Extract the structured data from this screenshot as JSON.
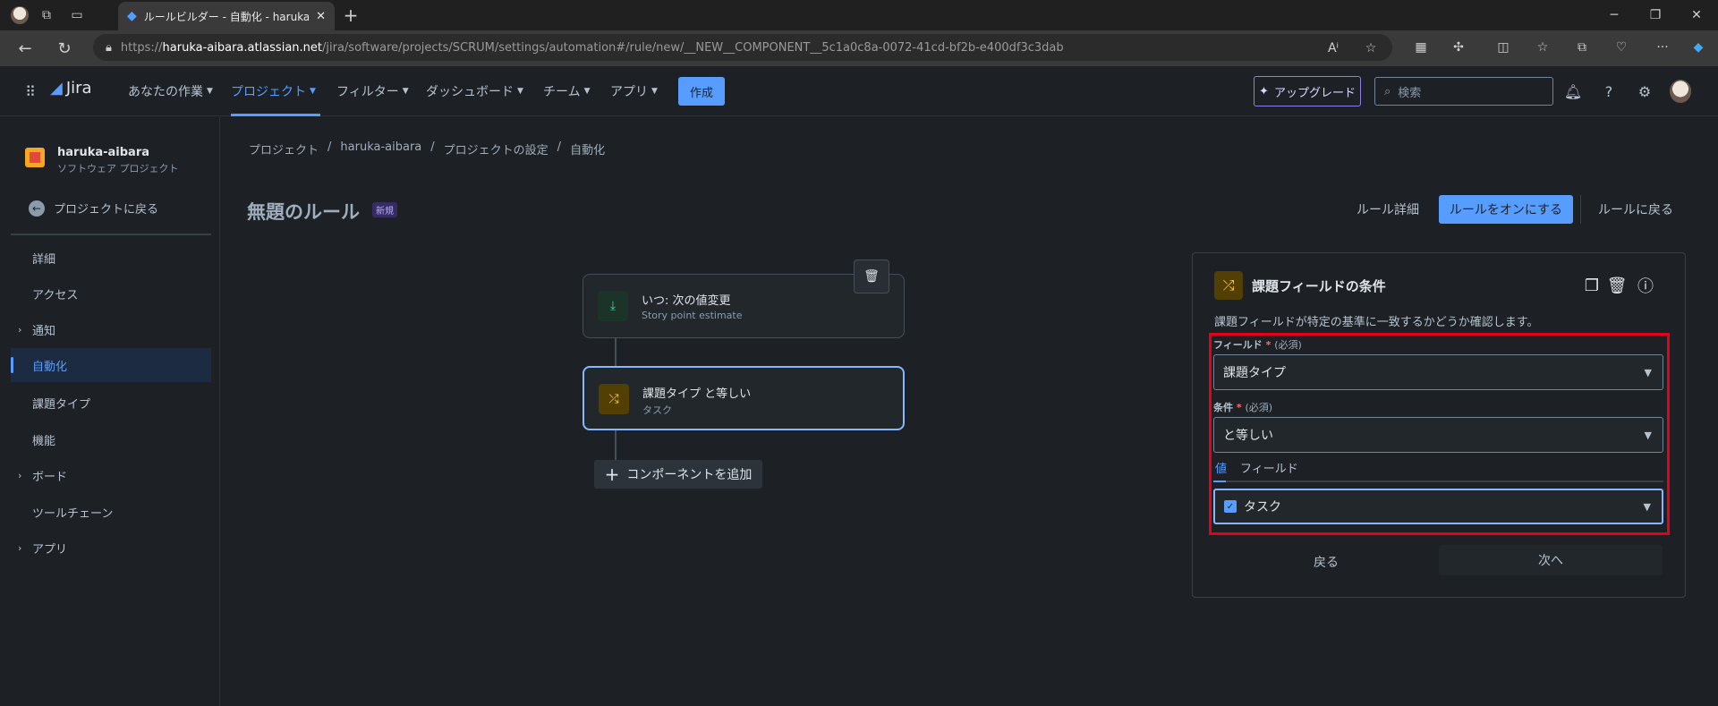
{
  "browser": {
    "tab_title": "ルールビルダー - 自動化 - haruka-aib",
    "url_scheme": "https://",
    "url_host": "haruka-aibara.atlassian.net",
    "url_path": "/jira/software/projects/SCRUM/settings/automation#/rule/new/__NEW__COMPONENT__5c1a0c8a-0072-41cd-bf2b-e400df3c3dab"
  },
  "topnav": {
    "product": "Jira",
    "items": [
      "あなたの作業",
      "プロジェクト",
      "フィルター",
      "ダッシュボード",
      "チーム",
      "アプリ"
    ],
    "create": "作成",
    "upgrade": "アップグレード",
    "search_placeholder": "検索"
  },
  "sidebar": {
    "project_name": "haruka-aibara",
    "project_type": "ソフトウェア プロジェクト",
    "back": "プロジェクトに戻る",
    "items": [
      {
        "label": "詳細"
      },
      {
        "label": "アクセス"
      },
      {
        "label": "通知"
      },
      {
        "label": "自動化"
      },
      {
        "label": "課題タイプ"
      },
      {
        "label": "機能"
      },
      {
        "label": "ボード"
      },
      {
        "label": "ツールチェーン"
      },
      {
        "label": "アプリ"
      }
    ]
  },
  "breadcrumb": [
    "プロジェクト",
    "/",
    "haruka-aibara",
    "/",
    "プロジェクトの設定",
    "/",
    "自動化"
  ],
  "rule": {
    "title": "無題のルール",
    "badge": "新規",
    "details_link": "ルール詳細",
    "turn_on": "ルールをオンにする",
    "back_to_rules": "ルールに戻る"
  },
  "canvas": {
    "trigger_title": "いつ: 次の値変更",
    "trigger_sub": "Story point estimate",
    "condition_title": "課題タイプ と等しい",
    "condition_sub": "タスク",
    "add_component": "コンポーネントを追加"
  },
  "panel": {
    "title": "課題フィールドの条件",
    "description": "課題フィールドが特定の基準に一致するかどうか確認します。",
    "field_label": "フィールド",
    "field_value": "課題タイプ",
    "condition_label": "条件",
    "condition_value": "と等しい",
    "required_mark": "*",
    "required_hint": "(必須)",
    "tab_value": "値",
    "tab_field": "フィールド",
    "selected_value": "タスク",
    "back": "戻る",
    "next": "次へ"
  },
  "colors": {
    "accent": "#579dff",
    "highlight": "#e6001a",
    "background": "#1d2125"
  }
}
